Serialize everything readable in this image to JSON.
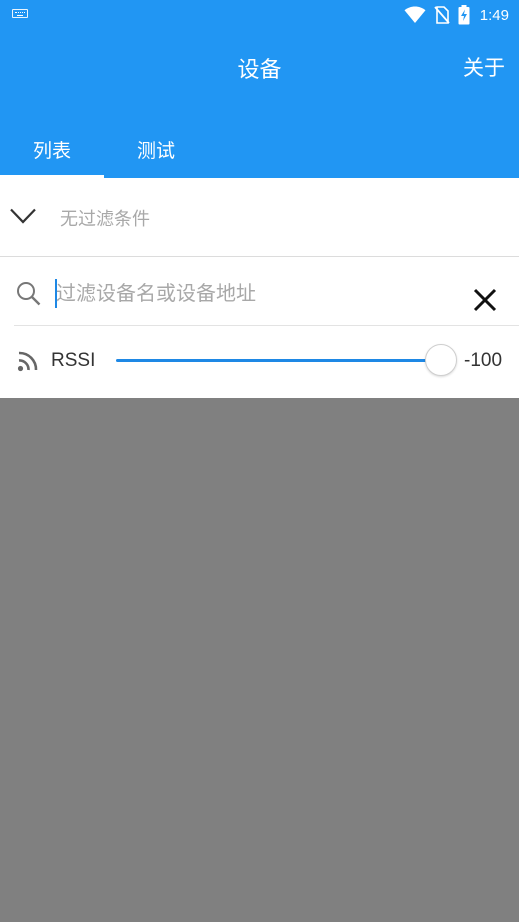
{
  "status_bar": {
    "time": "1:49",
    "icons": [
      "keyboard-icon",
      "wifi-icon",
      "no-sim-icon",
      "battery-charging-icon"
    ]
  },
  "app_bar": {
    "title": "设备",
    "about_label": "关于",
    "color": "#2196F3"
  },
  "tabs": [
    {
      "label": "列表",
      "active": true
    },
    {
      "label": "测试",
      "active": false
    }
  ],
  "filter": {
    "summary": "无过滤条件",
    "icon": "chevron-down-icon"
  },
  "search": {
    "placeholder": "过滤设备名或设备地址",
    "value": "",
    "icon": "search-icon",
    "clear_icon": "close-icon"
  },
  "rssi": {
    "label": "RSSI",
    "value": "-100",
    "icon": "rss-feed-icon",
    "slider_fraction": 0.95,
    "accent": "#1E88E5"
  },
  "colors": {
    "background_overlay": "#808080",
    "panel": "#FFFFFF"
  }
}
